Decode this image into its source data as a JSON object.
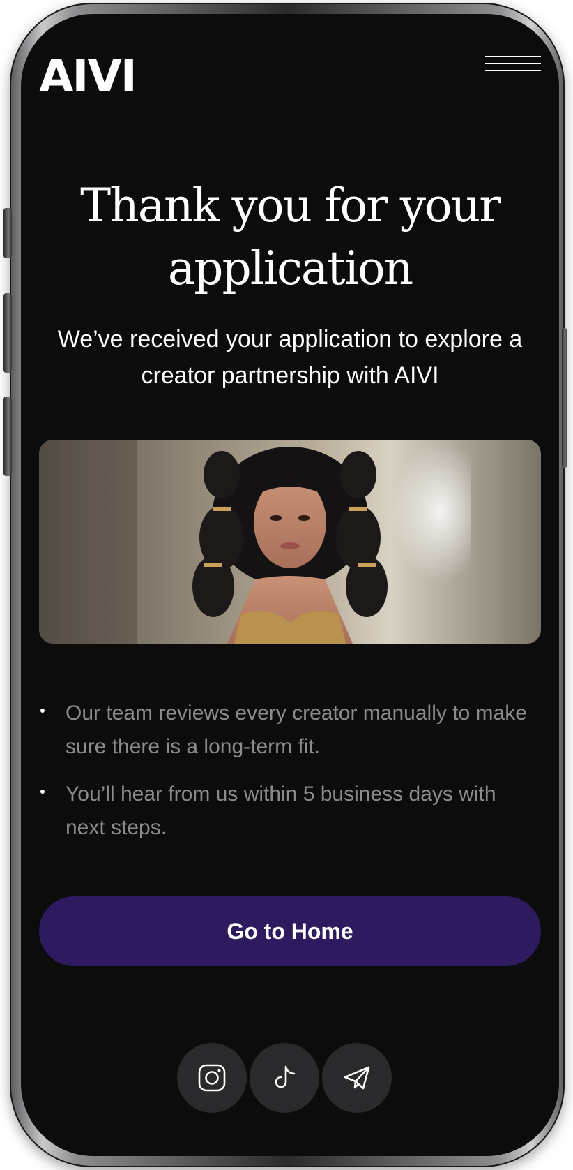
{
  "header": {
    "logo_text": "AIVI",
    "menu_icon": "hamburger-menu-icon"
  },
  "main": {
    "title": "Thank you for your application",
    "subtitle": "We’ve received your application to explore a creator partnership with AIVI",
    "bullets": [
      "Our team reviews every creator manually to make sure there is a long-term fit.",
      "You’ll hear from us within 5 business days with next steps."
    ],
    "cta_label": "Go to Home"
  },
  "social": [
    {
      "icon": "instagram-icon"
    },
    {
      "icon": "tiktok-icon"
    },
    {
      "icon": "telegram-icon"
    }
  ],
  "colors": {
    "background": "#0c0c0d",
    "accent": "#2e1a5e",
    "text_primary": "#ffffff",
    "text_secondary": "#8b8b8e",
    "social_button_bg": "#2a2a2c"
  }
}
